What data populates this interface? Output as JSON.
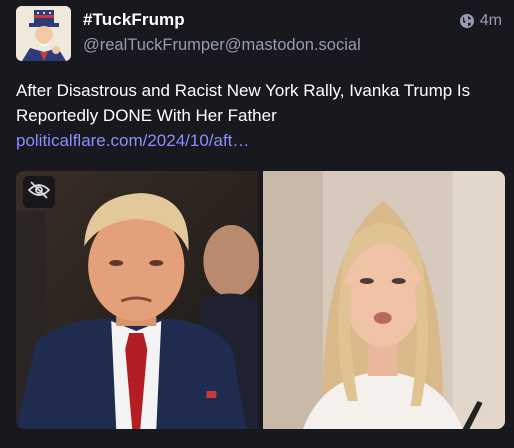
{
  "post": {
    "display_name": "#TuckFrump",
    "handle": "@realTuckFrumper@mastodon.social",
    "time": "4m",
    "visibility_icon": "globe-icon",
    "text": "After Disastrous and Racist New York Rally, Ivanka Trump Is Reportedly DONE With Her Father",
    "link_text": "politicalflare.com/2024/10/aft…",
    "media_hide_icon": "eye-slash-icon"
  },
  "colors": {
    "background": "#18181f",
    "text": "#ffffff",
    "muted": "#9a9aaf",
    "link": "#8c8dff"
  }
}
